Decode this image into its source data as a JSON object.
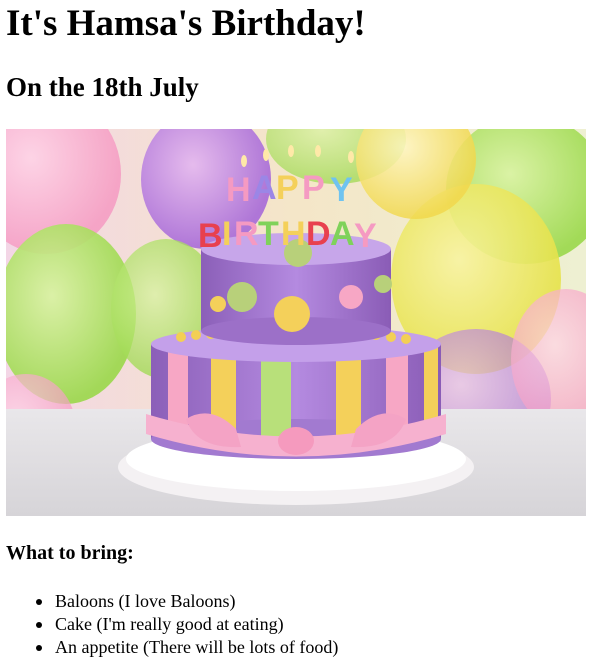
{
  "heading": "It's Hamsa's Birthday!",
  "subheading": "On the 18th July",
  "image": {
    "candle_letters_top": "HAPPY",
    "candle_letters_bottom": "BIRTHDAY"
  },
  "bring_heading": "What to bring:",
  "bring_items": [
    "Baloons (I love Baloons)",
    "Cake (I'm really good at eating)",
    "An appetite (There will be lots of food)"
  ]
}
